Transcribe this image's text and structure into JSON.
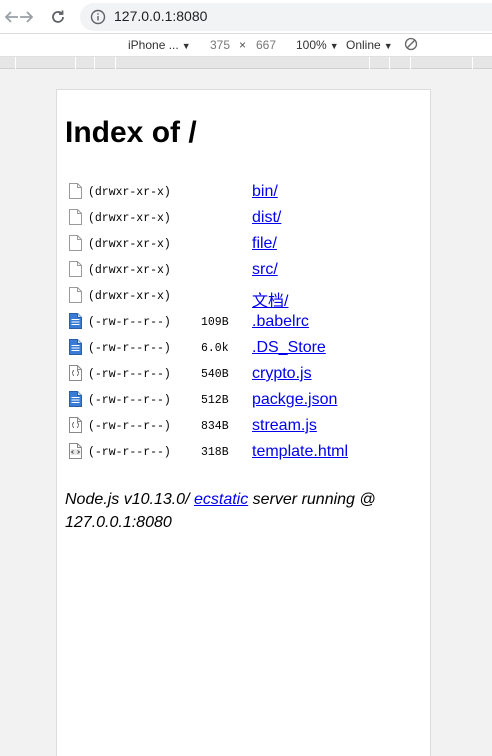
{
  "browser": {
    "url": "127.0.0.1:8080"
  },
  "device_toolbar": {
    "device": "iPhone ...",
    "width": "375",
    "times": "×",
    "height": "667",
    "zoom": "100%",
    "network": "Online"
  },
  "page": {
    "title": "Index of /",
    "entries": [
      {
        "icon": "folder-file-icon",
        "perm": "(drwxr-xr-x)",
        "size": "",
        "name": "bin/"
      },
      {
        "icon": "folder-file-icon",
        "perm": "(drwxr-xr-x)",
        "size": "",
        "name": "dist/"
      },
      {
        "icon": "folder-file-icon",
        "perm": "(drwxr-xr-x)",
        "size": "",
        "name": "file/"
      },
      {
        "icon": "folder-file-icon",
        "perm": "(drwxr-xr-x)",
        "size": "",
        "name": "src/"
      },
      {
        "icon": "folder-file-icon",
        "perm": "(drwxr-xr-x)",
        "size": "",
        "name": "文档/"
      },
      {
        "icon": "text-file-icon",
        "perm": "(-rw-r--r--)",
        "size": "109B",
        "name": ".babelrc"
      },
      {
        "icon": "text-file-icon",
        "perm": "(-rw-r--r--)",
        "size": "6.0k",
        "name": ".DS_Store"
      },
      {
        "icon": "script-file-icon",
        "perm": "(-rw-r--r--)",
        "size": "540B",
        "name": "crypto.js"
      },
      {
        "icon": "text-file-icon",
        "perm": "(-rw-r--r--)",
        "size": "512B",
        "name": "packge.json"
      },
      {
        "icon": "script-file-icon",
        "perm": "(-rw-r--r--)",
        "size": "834B",
        "name": "stream.js"
      },
      {
        "icon": "html-file-icon",
        "perm": "(-rw-r--r--)",
        "size": "318B",
        "name": "template.html"
      }
    ],
    "footer": {
      "prefix": "Node.js v10.13.0/ ",
      "link": "ecstatic",
      "suffix": " server running @ 127.0.0.1:8080"
    }
  },
  "colors": {
    "link": "#0000ee",
    "text_file_icon": "#3a7bd5"
  }
}
